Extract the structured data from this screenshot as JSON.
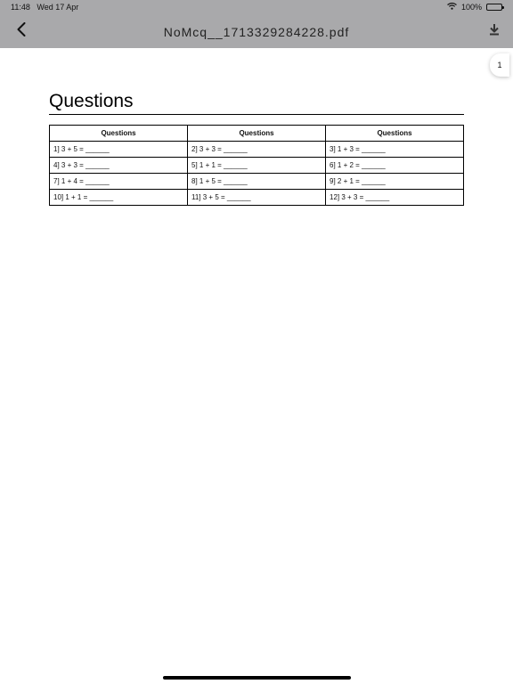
{
  "status_bar": {
    "time": "11:48",
    "date": "Wed 17 Apr",
    "battery": "100%"
  },
  "nav": {
    "title": "NoMcq__1713329284228.pdf"
  },
  "page_indicator": "1",
  "document": {
    "title": "Questions",
    "headers": [
      "Questions",
      "Questions",
      "Questions"
    ],
    "rows": [
      [
        "1] 3 + 5 = ______",
        "2] 3 + 3 = ______",
        "3] 1 + 3 = ______"
      ],
      [
        "4] 3 + 3 = ______",
        "5] 1 + 1 = ______",
        "6] 1 + 2 = ______"
      ],
      [
        "7] 1 + 4 = ______",
        "8] 1 + 5 = ______",
        "9] 2 + 1 = ______"
      ],
      [
        "10] 1 + 1 = ______",
        "11] 3 + 5 = ______",
        "12] 3 + 3 = ______"
      ]
    ]
  },
  "colors": {
    "toolbar": "#a9a9ab",
    "page": "#ffffff"
  },
  "icons": {
    "back": "chevron-left-icon",
    "download": "download-icon",
    "wifi": "wifi-icon",
    "battery": "battery-icon"
  }
}
